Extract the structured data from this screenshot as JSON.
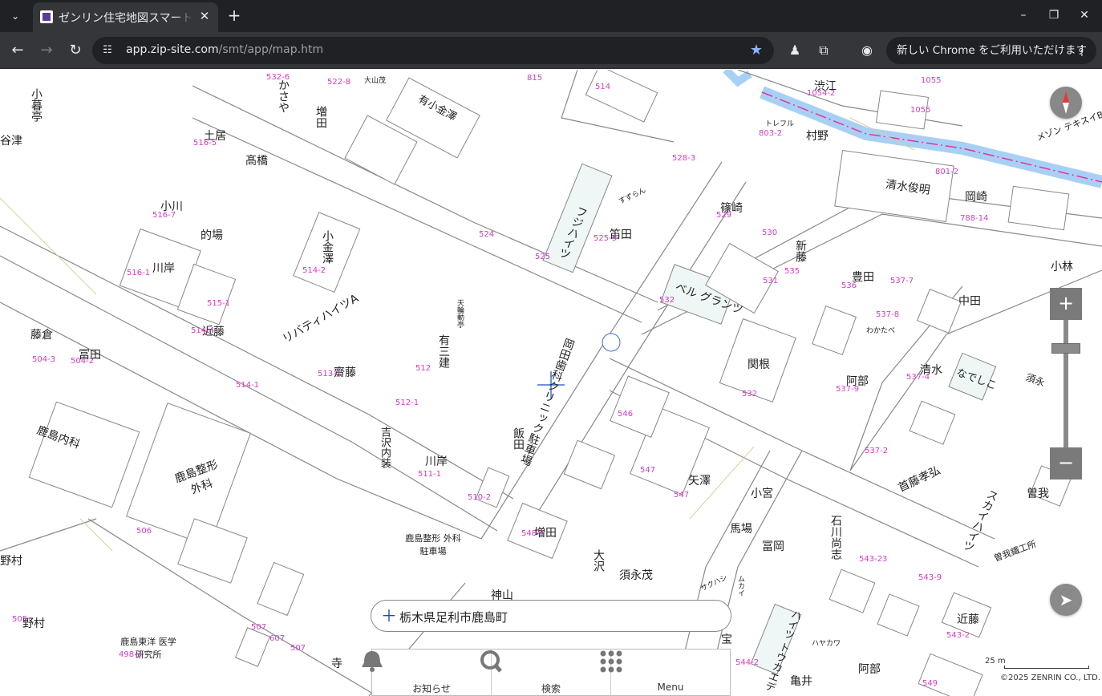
{
  "browser": {
    "tab_title": "ゼンリン住宅地図スマートフォン",
    "tab_close": "✕",
    "new_tab": "+",
    "url_domain": "app.zip-site.com",
    "url_path": "/smt/app/map.htm",
    "update_chip": "新しい Chrome をご利用いただけます",
    "window_controls": {
      "minimize": "–",
      "maximize": "❐",
      "close": "✕"
    }
  },
  "map": {
    "labels": [
      {
        "t": "小暮亭",
        "v": true
      },
      {
        "t": "かさや",
        "v": true
      },
      {
        "t": "増田",
        "v": true
      },
      {
        "t": "大山茂",
        "v": false
      },
      {
        "t": "有小金澤",
        "v": false
      },
      {
        "t": "渋江",
        "v": false
      },
      {
        "t": "トレフル",
        "v": false
      },
      {
        "t": "村野",
        "v": false
      },
      {
        "t": "清水俊明",
        "v": false
      },
      {
        "t": "岡崎",
        "v": false
      },
      {
        "t": "メゾン テキスイB",
        "v": false
      },
      {
        "t": "谷津",
        "v": false
      },
      {
        "t": "土居",
        "v": false
      },
      {
        "t": "髙橋",
        "v": false
      },
      {
        "t": "すずらん",
        "v": false
      },
      {
        "t": "フジハイツ",
        "v": true
      },
      {
        "t": "笛田",
        "v": false
      },
      {
        "t": "篠崎",
        "v": false
      },
      {
        "t": "新藤",
        "v": true
      },
      {
        "t": "豊田",
        "v": false
      },
      {
        "t": "小林",
        "v": false
      },
      {
        "t": "小川",
        "v": false
      },
      {
        "t": "的場",
        "v": false
      },
      {
        "t": "小金澤",
        "v": true
      },
      {
        "t": "川岸",
        "v": false
      },
      {
        "t": "リバティハイツA",
        "v": true
      },
      {
        "t": "ベル グランツ",
        "v": false
      },
      {
        "t": "中田",
        "v": false
      },
      {
        "t": "天輪動亭",
        "v": true
      },
      {
        "t": "岡田歯科クリニック駐車場",
        "v": true
      },
      {
        "t": "関根",
        "v": false
      },
      {
        "t": "わかたべ",
        "v": false
      },
      {
        "t": "清水",
        "v": false
      },
      {
        "t": "なでしこ",
        "v": false
      },
      {
        "t": "藤倉",
        "v": false
      },
      {
        "t": "冨田",
        "v": false
      },
      {
        "t": "近藤",
        "v": false
      },
      {
        "t": "齋藤",
        "v": false
      },
      {
        "t": "有三建",
        "v": true
      },
      {
        "t": "阿部",
        "v": false
      },
      {
        "t": "須永",
        "v": false
      },
      {
        "t": "鹿島内科",
        "v": false
      },
      {
        "t": "鹿島整形 外科",
        "v": false
      },
      {
        "t": "吉沢内装",
        "v": true
      },
      {
        "t": "川岸",
        "v": false
      },
      {
        "t": "飯田",
        "v": true
      },
      {
        "t": "矢澤",
        "v": false
      },
      {
        "t": "首藤孝弘",
        "v": false
      },
      {
        "t": "スカイハイツ",
        "v": true
      },
      {
        "t": "曽我",
        "v": false
      },
      {
        "t": "小宮",
        "v": false
      },
      {
        "t": "馬場",
        "v": false
      },
      {
        "t": "冨岡",
        "v": false
      },
      {
        "t": "石川尚志",
        "v": true
      },
      {
        "t": "鹿島整形 外科駐車場",
        "v": false
      },
      {
        "t": "増田",
        "v": false
      },
      {
        "t": "大沢",
        "v": true
      },
      {
        "t": "須永茂",
        "v": false
      },
      {
        "t": "曽我鐵工所",
        "v": false
      },
      {
        "t": "野村",
        "v": false
      },
      {
        "t": "野村",
        "v": false
      },
      {
        "t": "鹿島東洋 医学研究所",
        "v": false
      },
      {
        "t": "寺",
        "v": false
      },
      {
        "t": "神山",
        "v": false
      },
      {
        "t": "ハイツ トウカエデ",
        "v": true
      },
      {
        "t": "ハヤカワ",
        "v": false
      },
      {
        "t": "阿部",
        "v": false
      },
      {
        "t": "近藤",
        "v": false
      },
      {
        "t": "亀井",
        "v": false
      },
      {
        "t": "宝",
        "v": false
      },
      {
        "t": "ムカイ",
        "v": true
      },
      {
        "t": "サクハシ",
        "v": false
      }
    ],
    "numbers": [
      "532-6",
      "522-8",
      "815",
      "514",
      "803-2",
      "1054-2",
      "1055",
      "1055",
      "801-2",
      "788-14",
      "524",
      "528-3",
      "525",
      "525-5",
      "529",
      "530",
      "535",
      "536",
      "537-7",
      "516-7",
      "516-5",
      "514-2",
      "531",
      "532",
      "537-8",
      "537-9",
      "516-1",
      "515-1",
      "514-4",
      "513-1",
      "512",
      "532",
      "537-4",
      "504-3",
      "504-2",
      "514-1",
      "512-1",
      "546",
      "547",
      "537-2",
      "511-1",
      "510-2",
      "506",
      "548-1",
      "547",
      "543-23",
      "543-9",
      "544-2",
      "505",
      "507",
      "607",
      "507",
      "498-3",
      "549",
      "543-2"
    ],
    "address": "栃木県足利市鹿島町",
    "scale": "25 m",
    "copyright": "©2025 ZENRIN CO., LTD."
  },
  "bottom_nav": {
    "notice": "お知らせ",
    "search": "検索",
    "menu": "Menu"
  },
  "colors": {
    "road_line": "#888888",
    "parcel_number": "#d23cc2",
    "river": "#a8d0f5",
    "river_center": "#e0359b"
  }
}
